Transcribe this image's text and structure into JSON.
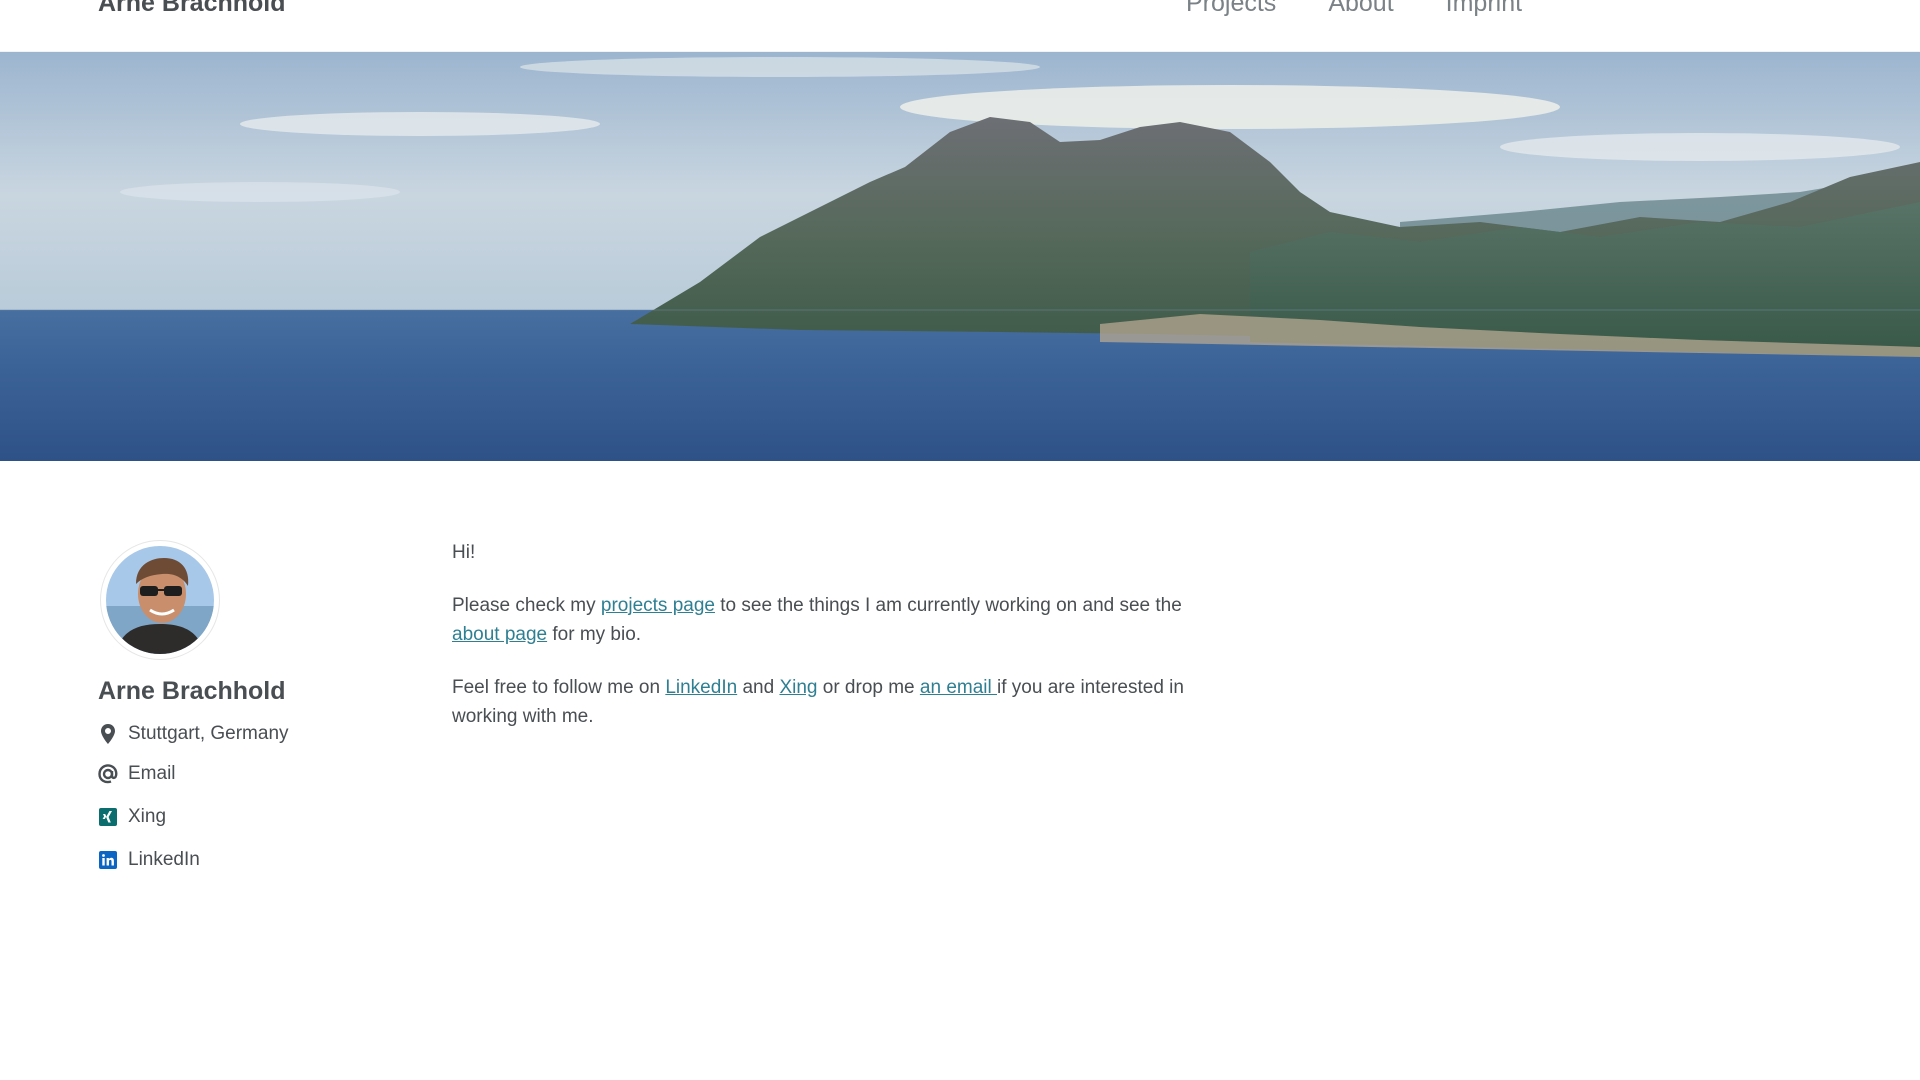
{
  "masthead": {
    "site_title": "Arne Brachhold",
    "nav": [
      {
        "label": "Projects"
      },
      {
        "label": "About"
      },
      {
        "label": "Imprint"
      }
    ]
  },
  "author": {
    "name": "Arne Brachhold",
    "links": [
      {
        "icon": "location-pin-icon",
        "label": "Stuttgart, Germany"
      },
      {
        "icon": "at-sign-icon",
        "label": "Email"
      },
      {
        "icon": "xing-icon",
        "label": "Xing"
      },
      {
        "icon": "linkedin-icon",
        "label": "LinkedIn"
      }
    ]
  },
  "content": {
    "greeting": "Hi!",
    "p2": {
      "t1": "Please check my ",
      "link1": "projects page",
      "t2": " to see the things I am currently working on and see the ",
      "link2": "about page",
      "t3": " for my bio."
    },
    "p3": {
      "t1": "Feel free to follow me on ",
      "link1": "LinkedIn",
      "t2": " and ",
      "link2": "Xing",
      "t3": " or drop me ",
      "link3": "an email ",
      "t4": "if you are interested in working with me."
    }
  },
  "colors": {
    "text": "#494e52",
    "nav_text": "#7a8288",
    "link": "#2f7f93",
    "icon": "#2f7f93"
  }
}
